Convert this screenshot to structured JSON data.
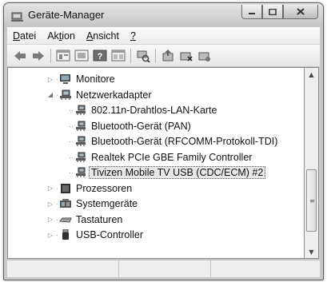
{
  "window": {
    "title": "Geräte-Manager",
    "caption_buttons": [
      "minimize",
      "maximize",
      "close"
    ]
  },
  "menu": [
    {
      "label_pre": "",
      "label_key": "D",
      "label_post": "atei"
    },
    {
      "label_pre": "Ak",
      "label_key": "t",
      "label_post": "ion"
    },
    {
      "label_pre": "",
      "label_key": "A",
      "label_post": "nsicht"
    },
    {
      "label_pre": "",
      "label_key": "?",
      "label_post": ""
    }
  ],
  "toolbar": {
    "buttons": [
      "back-arrow-icon",
      "forward-arrow-icon",
      "properties-list-icon",
      "view-icon",
      "help-icon",
      "console-view-icon",
      "scan-hardware-icon",
      "update-driver-icon",
      "disable-device-icon",
      "uninstall-device-icon"
    ]
  },
  "tree": {
    "items": [
      {
        "label": "Monitore",
        "level": 1,
        "expander": "collapsed",
        "icon": "monitor-icon"
      },
      {
        "label": "Netzwerkadapter",
        "level": 1,
        "expander": "expanded",
        "icon": "network-adapter-icon"
      },
      {
        "label": "802.11n-Drahtlos-LAN-Karte",
        "level": 2,
        "icon": "network-card-icon"
      },
      {
        "label": "Bluetooth-Gerät (PAN)",
        "level": 2,
        "icon": "network-card-icon"
      },
      {
        "label": "Bluetooth-Gerät (RFCOMM-Protokoll-TDI)",
        "level": 2,
        "icon": "network-card-icon"
      },
      {
        "label": "Realtek PCIe GBE Family Controller",
        "level": 2,
        "icon": "network-card-icon"
      },
      {
        "label": "Tivizen Mobile TV USB (CDC/ECM) #2",
        "level": 2,
        "icon": "network-card-icon",
        "selected": true
      },
      {
        "label": "Prozessoren",
        "level": 1,
        "expander": "collapsed",
        "icon": "processor-icon"
      },
      {
        "label": "Systemgeräte",
        "level": 1,
        "expander": "collapsed",
        "icon": "system-devices-icon"
      },
      {
        "label": "Tastaturen",
        "level": 1,
        "expander": "collapsed",
        "icon": "keyboard-icon"
      },
      {
        "label": "USB-Controller",
        "level": 1,
        "expander": "collapsed",
        "icon": "usb-icon"
      }
    ]
  },
  "colors": {
    "selection_bg": "#e8e8e8",
    "window_frame": "#c9c9c9"
  }
}
